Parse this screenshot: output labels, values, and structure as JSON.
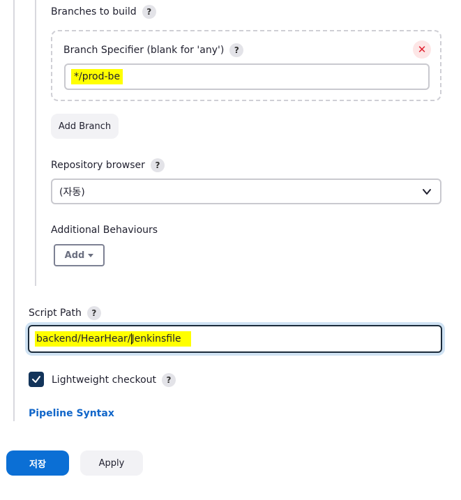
{
  "git": {
    "branches_label": "Branches to build",
    "branch_specifier_label": "Branch Specifier (blank for 'any')",
    "branch_specifier_value": "*/prod-be",
    "add_branch_label": "Add Branch",
    "repo_browser_label": "Repository browser",
    "repo_browser_value": "(자동)",
    "additional_behaviours_label": "Additional Behaviours",
    "add_label": "Add"
  },
  "script": {
    "label": "Script Path",
    "value_before_caret": "backend/HearHear/",
    "value_after_caret": "Jenkinsfile",
    "lightweight_label": "Lightweight checkout",
    "lightweight_checked": true
  },
  "links": {
    "pipeline_syntax": "Pipeline Syntax"
  },
  "help_glyph": "?",
  "footer": {
    "save_label": "저장",
    "apply_label": "Apply"
  }
}
